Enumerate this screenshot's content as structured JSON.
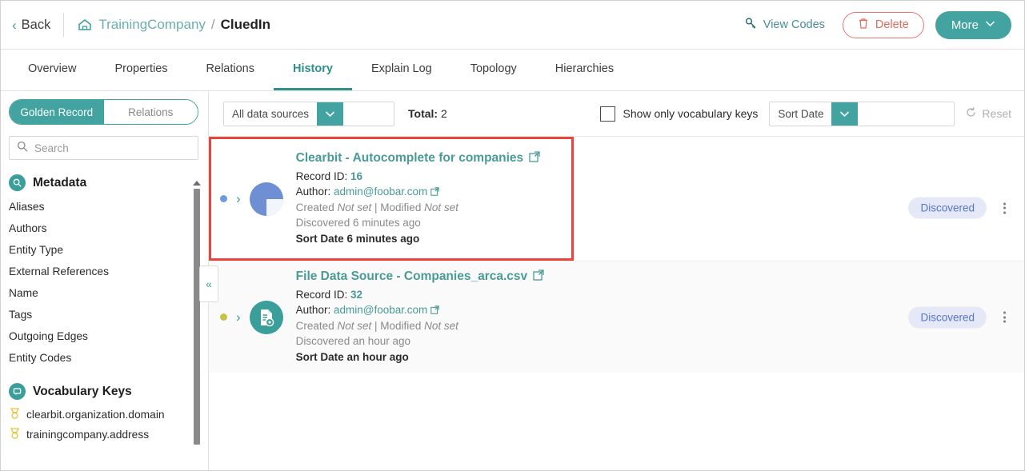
{
  "header": {
    "back_label": "Back",
    "home_icon": "home-icon",
    "breadcrumb_company": "TrainingCompany",
    "breadcrumb_separator": "/",
    "breadcrumb_current": "CluedIn",
    "view_codes_label": "View Codes",
    "view_codes_icon": "key-icon",
    "delete_label": "Delete",
    "delete_icon": "trash-icon",
    "more_label": "More",
    "more_icon": "chevron-down-icon"
  },
  "tabs": [
    {
      "label": "Overview",
      "active": false
    },
    {
      "label": "Properties",
      "active": false
    },
    {
      "label": "Relations",
      "active": false
    },
    {
      "label": "History",
      "active": true
    },
    {
      "label": "Explain Log",
      "active": false
    },
    {
      "label": "Topology",
      "active": false
    },
    {
      "label": "Hierarchies",
      "active": false
    }
  ],
  "sidebar": {
    "toggle": {
      "left_label": "Golden Record",
      "right_label": "Relations",
      "active": "Golden Record"
    },
    "search": {
      "placeholder": "Search",
      "value": "",
      "icon": "search-icon"
    },
    "metadata": {
      "title": "Metadata",
      "icon": "magnifier-circle-icon",
      "items": [
        "Aliases",
        "Authors",
        "Entity Type",
        "External References",
        "Name",
        "Tags",
        "Outgoing Edges",
        "Entity Codes"
      ]
    },
    "vocabulary": {
      "title": "Vocabulary Keys",
      "icon": "speech-bubble-circle-icon",
      "items": [
        {
          "label": "clearbit.organization.domain",
          "icon": "vocabulary-key-icon"
        },
        {
          "label": "trainingcompany.address",
          "icon": "vocabulary-key-icon"
        }
      ]
    },
    "collapse_icon": "double-chevron-left-icon"
  },
  "toolbar": {
    "data_source_select": {
      "value": "All data sources",
      "icon": "chevron-down-icon"
    },
    "total_label": "Total:",
    "total_value": "2",
    "vocab_checkbox": {
      "label": "Show only vocabulary keys",
      "checked": false
    },
    "sort_select": {
      "value": "Sort Date",
      "icon": "chevron-down-icon"
    },
    "reset_label": "Reset",
    "reset_icon": "refresh-icon",
    "reset_disabled": true
  },
  "records": [
    {
      "title": "Clearbit - Autocomplete for companies",
      "title_external_icon": "external-link-icon",
      "record_id_label": "Record ID:",
      "record_id_value": "16",
      "author_label": "Author:",
      "author_value": "admin@foobar.com",
      "author_external_icon": "external-link-icon",
      "created_label": "Created",
      "created_value": "Not set",
      "modified_label": "Modified",
      "modified_value": "Not set",
      "discovered_label": "Discovered",
      "discovered_value": "6 minutes ago",
      "sort_date_label": "Sort Date",
      "sort_date_value": "6 minutes ago",
      "status_badge": "Discovered",
      "avatar_icon": "pie-chart-icon",
      "dot_color": "#6e9bd8",
      "menu_icon": "kebab-menu-icon",
      "highlighted": true
    },
    {
      "title": "File Data Source - Companies_arca.csv",
      "title_external_icon": "external-link-icon",
      "record_id_label": "Record ID:",
      "record_id_value": "32",
      "author_label": "Author:",
      "author_value": "admin@foobar.com",
      "author_external_icon": "external-link-icon",
      "created_label": "Created",
      "created_value": "Not set",
      "modified_label": "Modified",
      "modified_value": "Not set",
      "discovered_label": "Discovered",
      "discovered_value": "an hour ago",
      "sort_date_label": "Sort Date",
      "sort_date_value": "an hour ago",
      "status_badge": "Discovered",
      "avatar_icon": "file-settings-icon",
      "dot_color": "#c5c442",
      "menu_icon": "kebab-menu-icon",
      "highlighted": false
    }
  ],
  "colors": {
    "accent_teal": "#42a3a0",
    "link_teal": "#4a9a98",
    "delete_red": "#e26a5d",
    "highlight_red": "#e8453c",
    "badge_bg": "#e4e8f7",
    "badge_text": "#5876c8",
    "vocab_gold": "#e3c53d"
  }
}
